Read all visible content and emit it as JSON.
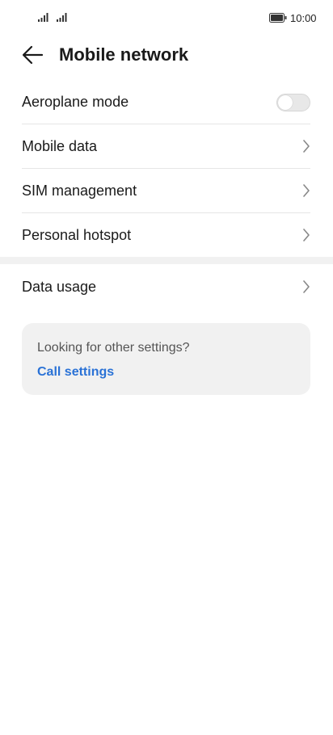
{
  "status_bar": {
    "time": "10:00"
  },
  "header": {
    "title": "Mobile network"
  },
  "settings": {
    "aeroplane_mode": {
      "label": "Aeroplane mode",
      "enabled": false
    },
    "mobile_data": {
      "label": "Mobile data"
    },
    "sim_management": {
      "label": "SIM management"
    },
    "personal_hotspot": {
      "label": "Personal hotspot"
    },
    "data_usage": {
      "label": "Data usage"
    }
  },
  "card": {
    "text": "Looking for other settings?",
    "link": "Call settings"
  },
  "colors": {
    "accent": "#2a72d6",
    "divider": "#f1f1f1"
  }
}
